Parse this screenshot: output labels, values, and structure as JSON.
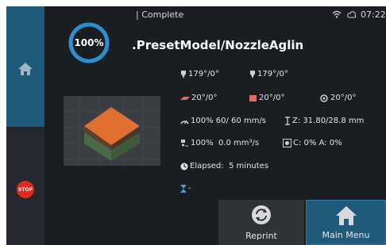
{
  "status": {
    "text": "| Complete",
    "time": "07:22"
  },
  "job": {
    "progress_label": "100%",
    "progress_fraction": 1.0,
    "filename": ".PresetModel/NozzleAglin"
  },
  "temps": {
    "extruder1": "179°/0°",
    "extruder2": "179°/0°",
    "bed": "20°/0°",
    "chamber": "20°/0°",
    "fan_temp": "20°/0°"
  },
  "motion": {
    "speed_pct": "100%",
    "speed_val": "60/ 60 mm/s",
    "z_label": "Z:",
    "z_val": "31.80/28.8 mm",
    "flow_pct": "100%",
    "flow_val": "0.0 mm³/s",
    "ca_label": "C:",
    "ca_val": "0% A:  0%"
  },
  "elapsed": {
    "label": "Elapsed:",
    "value": "5 minutes"
  },
  "eta": {
    "value": "-"
  },
  "buttons": {
    "reprint": "Reprint",
    "main_menu": "Main Menu"
  },
  "sidebar": {
    "stop_label": "STOP"
  },
  "colors": {
    "accent": "#1f5a7a",
    "progress_ring": "#2b8fd0",
    "stop": "#e02a1f",
    "model_top": "#e07030"
  },
  "icons": {
    "side_home": "home-icon",
    "stop": "stop-icon",
    "wifi": "wifi-icon",
    "cloud": "cloud-icon",
    "extruder": "nozzle-icon",
    "bed": "bed-icon",
    "chamber": "chamber-icon",
    "fan": "fan-icon",
    "speed": "speedometer-icon",
    "z": "z-height-icon",
    "flow": "flow-icon",
    "ca": "axis-icon",
    "elapsed": "clock-icon",
    "eta": "hourglass-icon",
    "reprint": "refresh-icon",
    "main_menu": "home-icon"
  }
}
